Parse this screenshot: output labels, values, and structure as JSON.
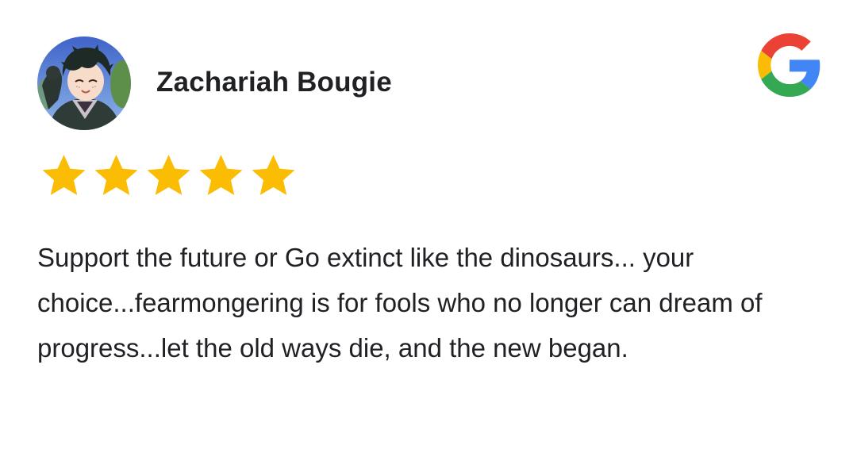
{
  "review": {
    "reviewer_name": "Zachariah Bougie",
    "rating": 5,
    "rating_max": 5,
    "text": "Support the future or Go extinct like the dinosaurs... your choice...fearmongering is for fools who no longer can dream of progress...let the old ways die, and the new began."
  },
  "icons": {
    "avatar": "avatar-photo",
    "source": "google-g-icon",
    "star": "star-icon"
  },
  "colors": {
    "star": "#FBBC04",
    "text": "#202124",
    "google_blue": "#4285F4",
    "google_red": "#EA4335",
    "google_yellow": "#FBBC05",
    "google_green": "#34A853"
  }
}
